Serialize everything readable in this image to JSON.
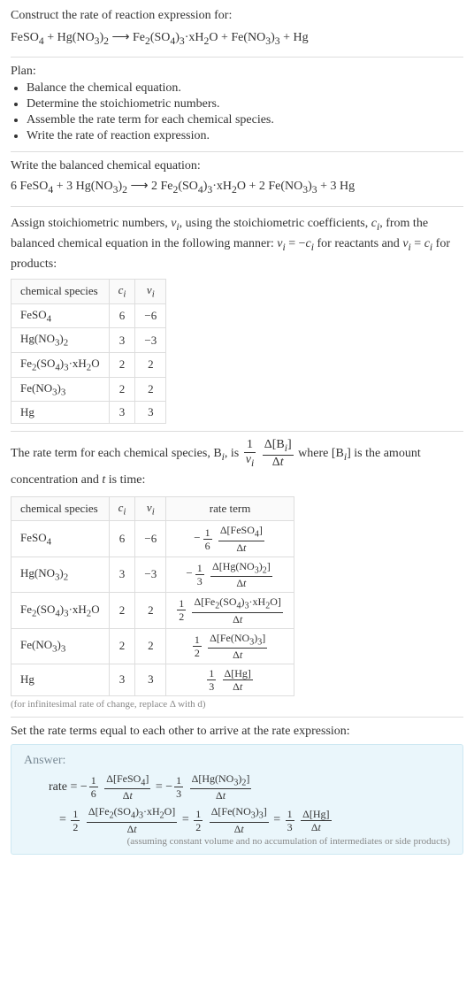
{
  "header": {
    "construct_label": "Construct the rate of reaction expression for:",
    "equation_html": "FeSO<sub>4</sub> + Hg(NO<sub>3</sub>)<sub>2</sub> ⟶ Fe<sub>2</sub>(SO<sub>4</sub>)<sub>3</sub>·xH<sub>2</sub>O + Fe(NO<sub>3</sub>)<sub>3</sub> + Hg"
  },
  "plan": {
    "title": "Plan:",
    "items": [
      "Balance the chemical equation.",
      "Determine the stoichiometric numbers.",
      "Assemble the rate term for each chemical species.",
      "Write the rate of reaction expression."
    ]
  },
  "balanced": {
    "label": "Write the balanced chemical equation:",
    "equation_html": "6 FeSO<sub>4</sub> + 3 Hg(NO<sub>3</sub>)<sub>2</sub> ⟶ 2 Fe<sub>2</sub>(SO<sub>4</sub>)<sub>3</sub>·xH<sub>2</sub>O + 2 Fe(NO<sub>3</sub>)<sub>3</sub> + 3 Hg"
  },
  "stoich": {
    "intro_html": "Assign stoichiometric numbers, <i>ν<sub>i</sub></i>, using the stoichiometric coefficients, <i>c<sub>i</sub></i>, from the balanced chemical equation in the following manner: <i>ν<sub>i</sub></i> = −<i>c<sub>i</sub></i> for reactants and <i>ν<sub>i</sub></i> = <i>c<sub>i</sub></i> for products:",
    "headers": {
      "species": "chemical species",
      "ci_html": "<i>c<sub>i</sub></i>",
      "nui_html": "<i>ν<sub>i</sub></i>"
    },
    "rows": [
      {
        "species_html": "FeSO<sub>4</sub>",
        "ci": "6",
        "nui": "−6"
      },
      {
        "species_html": "Hg(NO<sub>3</sub>)<sub>2</sub>",
        "ci": "3",
        "nui": "−3"
      },
      {
        "species_html": "Fe<sub>2</sub>(SO<sub>4</sub>)<sub>3</sub>·xH<sub>2</sub>O",
        "ci": "2",
        "nui": "2"
      },
      {
        "species_html": "Fe(NO<sub>3</sub>)<sub>3</sub>",
        "ci": "2",
        "nui": "2"
      },
      {
        "species_html": "Hg",
        "ci": "3",
        "nui": "3"
      }
    ]
  },
  "rate_intro": {
    "text_html": "The rate term for each chemical species, B<sub><i>i</i></sub>, is <span class='frac big'><span class='num'>1</span><span class='den'><i>ν<sub>i</sub></i></span></span> <span class='frac big'><span class='num'>Δ[B<sub><i>i</i></sub>]</span><span class='den'>Δ<i>t</i></span></span> where [B<sub><i>i</i></sub>] is the amount concentration and <i>t</i> is time:"
  },
  "rate_table": {
    "headers": {
      "species": "chemical species",
      "ci_html": "<i>c<sub>i</sub></i>",
      "nui_html": "<i>ν<sub>i</sub></i>",
      "rate": "rate term"
    },
    "rows": [
      {
        "species_html": "FeSO<sub>4</sub>",
        "ci": "6",
        "nui": "−6",
        "rate_html": "<span class='rate-term'><span class='neg'>−</span><span class='frac'><span class='num'>1</span><span class='den'>6</span></span> <span class='frac'><span class='num'>Δ[FeSO<sub>4</sub>]</span><span class='den'>Δ<i>t</i></span></span></span>"
      },
      {
        "species_html": "Hg(NO<sub>3</sub>)<sub>2</sub>",
        "ci": "3",
        "nui": "−3",
        "rate_html": "<span class='rate-term'><span class='neg'>−</span><span class='frac'><span class='num'>1</span><span class='den'>3</span></span> <span class='frac'><span class='num'>Δ[Hg(NO<sub>3</sub>)<sub>2</sub>]</span><span class='den'>Δ<i>t</i></span></span></span>"
      },
      {
        "species_html": "Fe<sub>2</sub>(SO<sub>4</sub>)<sub>3</sub>·xH<sub>2</sub>O",
        "ci": "2",
        "nui": "2",
        "rate_html": "<span class='rate-term'><span class='frac'><span class='num'>1</span><span class='den'>2</span></span> <span class='frac'><span class='num'>Δ[Fe<sub>2</sub>(SO<sub>4</sub>)<sub>3</sub>·xH<sub>2</sub>O]</span><span class='den'>Δ<i>t</i></span></span></span>"
      },
      {
        "species_html": "Fe(NO<sub>3</sub>)<sub>3</sub>",
        "ci": "2",
        "nui": "2",
        "rate_html": "<span class='rate-term'><span class='frac'><span class='num'>1</span><span class='den'>2</span></span> <span class='frac'><span class='num'>Δ[Fe(NO<sub>3</sub>)<sub>3</sub>]</span><span class='den'>Δ<i>t</i></span></span></span>"
      },
      {
        "species_html": "Hg",
        "ci": "3",
        "nui": "3",
        "rate_html": "<span class='rate-term'><span class='frac'><span class='num'>1</span><span class='den'>3</span></span> <span class='frac'><span class='num'>Δ[Hg]</span><span class='den'>Δ<i>t</i></span></span></span>"
      }
    ],
    "footnote": "(for infinitesimal rate of change, replace Δ with d)"
  },
  "final": {
    "intro": "Set the rate terms equal to each other to arrive at the rate expression:",
    "answer_label": "Answer:",
    "line1_html": "rate = −<span class='frac'><span class='num'>1</span><span class='den'>6</span></span> <span class='frac'><span class='num'>Δ[FeSO<sub>4</sub>]</span><span class='den'>Δ<i>t</i></span></span> = −<span class='frac'><span class='num'>1</span><span class='den'>3</span></span> <span class='frac'><span class='num'>Δ[Hg(NO<sub>3</sub>)<sub>2</sub>]</span><span class='den'>Δ<i>t</i></span></span>",
    "line2_html": "= <span class='frac'><span class='num'>1</span><span class='den'>2</span></span> <span class='frac'><span class='num'>Δ[Fe<sub>2</sub>(SO<sub>4</sub>)<sub>3</sub>·xH<sub>2</sub>O]</span><span class='den'>Δ<i>t</i></span></span> = <span class='frac'><span class='num'>1</span><span class='den'>2</span></span> <span class='frac'><span class='num'>Δ[Fe(NO<sub>3</sub>)<sub>3</sub>]</span><span class='den'>Δ<i>t</i></span></span> = <span class='frac'><span class='num'>1</span><span class='den'>3</span></span> <span class='frac'><span class='num'>Δ[Hg]</span><span class='den'>Δ<i>t</i></span></span>",
    "note": "(assuming constant volume and no accumulation of intermediates or side products)"
  }
}
